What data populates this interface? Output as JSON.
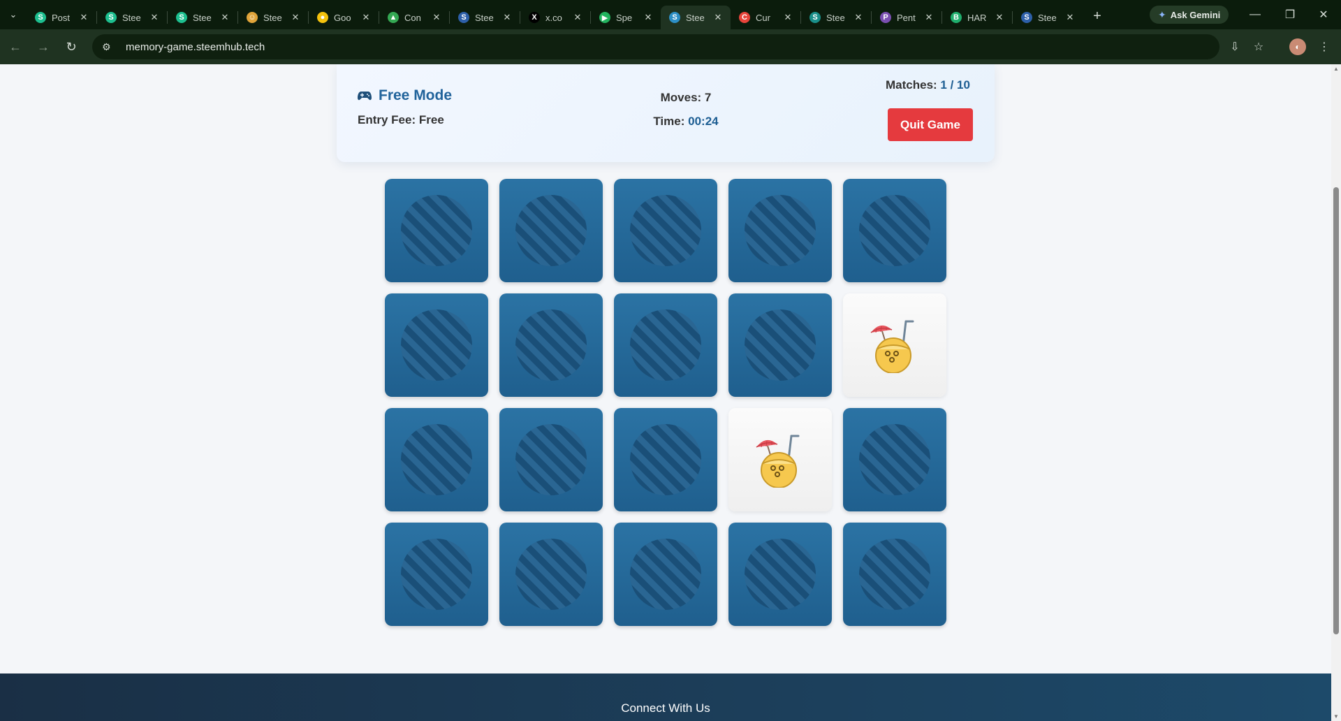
{
  "browser": {
    "tabs": [
      {
        "title": "Post",
        "fav_color": "#1dbf8f",
        "fav_glyph": "S"
      },
      {
        "title": "Stee",
        "fav_color": "#1dbf8f",
        "fav_glyph": "S"
      },
      {
        "title": "Stee",
        "fav_color": "#1dbf8f",
        "fav_glyph": "S"
      },
      {
        "title": "Stee",
        "fav_color": "#e0a43a",
        "fav_glyph": "☺"
      },
      {
        "title": "Goo",
        "fav_color": "#f4c20d",
        "fav_glyph": "●"
      },
      {
        "title": "Con",
        "fav_color": "#34a853",
        "fav_glyph": "▲"
      },
      {
        "title": "Stee",
        "fav_color": "#2d5fa8",
        "fav_glyph": "S"
      },
      {
        "title": "x.co",
        "fav_color": "#000000",
        "fav_glyph": "X"
      },
      {
        "title": "Spe",
        "fav_color": "#22b35e",
        "fav_glyph": "▶"
      },
      {
        "title": "Stee",
        "fav_color": "#2d8fc6",
        "fav_glyph": "S"
      },
      {
        "title": "Cur",
        "fav_color": "#e8443a",
        "fav_glyph": "C"
      },
      {
        "title": "Stee",
        "fav_color": "#1a8f8a",
        "fav_glyph": "S"
      },
      {
        "title": "Pent",
        "fav_color": "#7a4fb0",
        "fav_glyph": "P"
      },
      {
        "title": "HAR",
        "fav_color": "#1fae6d",
        "fav_glyph": "B"
      },
      {
        "title": "Stee",
        "fav_color": "#2d5fa8",
        "fav_glyph": "S"
      }
    ],
    "active_tab_index": 9,
    "ask_gemini_label": "Ask Gemini",
    "url": "memory-game.steemhub.tech"
  },
  "game": {
    "mode_label": "Free Mode",
    "entry_fee_label": "Entry Fee:",
    "entry_fee_value": "Free",
    "moves_label": "Moves:",
    "moves_value": "7",
    "time_label": "Time:",
    "time_value": "00:24",
    "matches_label": "Matches:",
    "matches_value": "1 / 10",
    "quit_label": "Quit Game"
  },
  "board": {
    "columns": 5,
    "rows": 4,
    "flipped": [
      {
        "index": 9,
        "icon": "coconut-drink-icon"
      },
      {
        "index": 13,
        "icon": "coconut-drink-icon"
      }
    ]
  },
  "footer": {
    "title": "Connect With Us"
  },
  "colors": {
    "card_back": "#2568a0",
    "quit_button": "#e53a3e",
    "mode_text": "#21639b"
  }
}
